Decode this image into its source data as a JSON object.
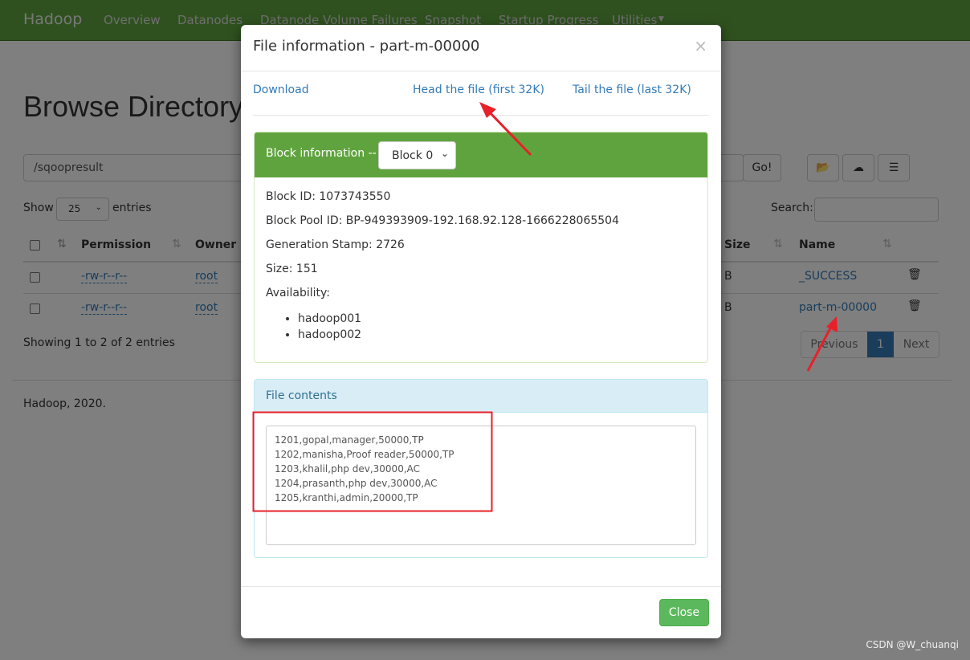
{
  "navbar": {
    "brand": "Hadoop",
    "items": [
      "Overview",
      "Datanodes",
      "Datanode Volume Failures",
      "Snapshot",
      "Startup Progress",
      "Utilities"
    ]
  },
  "page": {
    "title": "Browse Directory",
    "path": "/sqoopresult",
    "go_label": "Go!",
    "show_label": "Show",
    "entries_value": "25",
    "entries_label": "entries",
    "search_label": "Search:",
    "showing": "Showing 1 to 2 of 2 entries",
    "footer": "Hadoop, 2020.",
    "columns": [
      "Permission",
      "Owner",
      "Size",
      "Name"
    ],
    "rows": [
      {
        "permission": "-rw-r--r--",
        "owner": "root",
        "size": "B",
        "name": "_SUCCESS"
      },
      {
        "permission": "-rw-r--r--",
        "owner": "root",
        "size": "B",
        "name": "part-m-00000"
      }
    ],
    "pagination": {
      "previous": "Previous",
      "current": "1",
      "next": "Next"
    }
  },
  "modal": {
    "title": "File information - part-m-00000",
    "close_x": "×",
    "download": "Download",
    "head": "Head the file (first 32K)",
    "tail": "Tail the file (last 32K)",
    "block_heading": "Block information --",
    "block_select": "Block 0",
    "block_id": "Block ID: 1073743550",
    "pool_id": "Block Pool ID: BP-949393909-192.168.92.128-1666228065504",
    "gen_stamp": "Generation Stamp: 2726",
    "size": "Size: 151",
    "availability": "Availability:",
    "nodes": [
      "hadoop001",
      "hadoop002"
    ],
    "contents_heading": "File contents",
    "contents": "1201,gopal,manager,50000,TP\n1202,manisha,Proof reader,50000,TP\n1203,khalil,php dev,30000,AC\n1204,prasanth,php dev,30000,AC\n1205,kranthi,admin,20000,TP",
    "close_label": "Close"
  },
  "watermark": "CSDN @W_chuanqi",
  "colors": {
    "navbar": "#5fa33e",
    "block_heading": "#5fa33e",
    "contents_heading": "#d9edf7",
    "close_button": "#5cb85c",
    "annotation": "#e8202a"
  }
}
